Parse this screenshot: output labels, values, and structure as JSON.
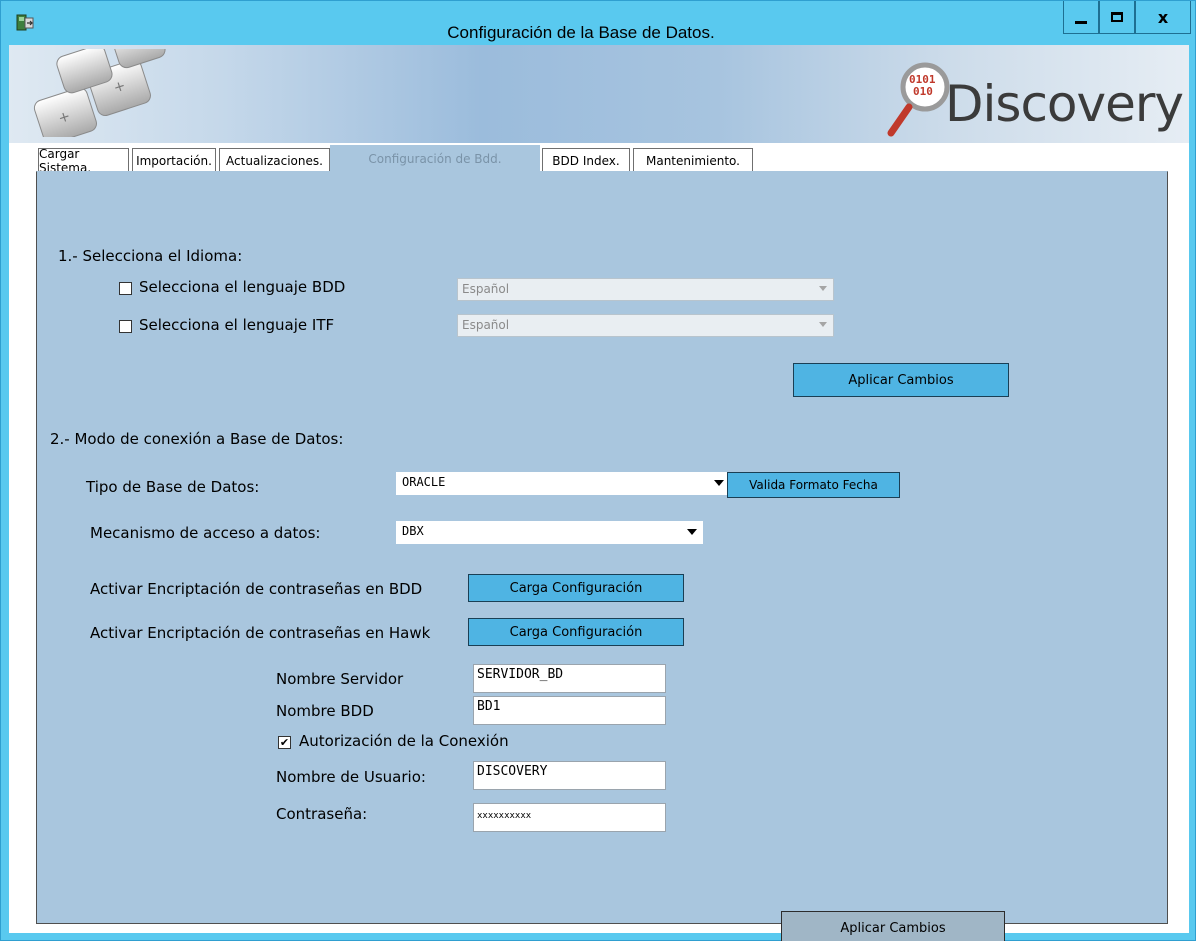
{
  "window": {
    "title": "Configuración de la Base de Datos.",
    "close_glyph": "x"
  },
  "banner": {
    "logo_text": "Discovery",
    "logo_binary": "0101"
  },
  "tabs": [
    {
      "label": "Cargar Sistema."
    },
    {
      "label": "Importación."
    },
    {
      "label": "Actualizaciones."
    },
    {
      "label": "Configuración de Bdd."
    },
    {
      "label": "BDD Index."
    },
    {
      "label": "Mantenimiento."
    }
  ],
  "active_tab": "Configuración de Bdd.",
  "section1": {
    "heading": "1.- Selecciona el Idioma:",
    "lang_bdd": {
      "label": "Selecciona el lenguaje BDD",
      "checked": false,
      "value": "Español"
    },
    "lang_itf": {
      "label": "Selecciona el lenguaje ITF",
      "checked": false,
      "value": "Español"
    },
    "apply_label": "Aplicar Cambios"
  },
  "section2": {
    "heading": "2.- Modo de conexión a Base de Datos:",
    "db_type_label": "Tipo de Base de Datos:",
    "db_type_value": "ORACLE",
    "validate_date_label": "Valida Formato Fecha",
    "access_label": "Mecanismo de acceso a datos:",
    "access_value": "DBX",
    "encrypt_bdd_label": "Activar Encriptación de contraseñas en BDD",
    "encrypt_hawk_label": "Activar Encriptación de contraseñas en Hawk",
    "load_config_label": "Carga Configuración",
    "server_label": "Nombre Servidor",
    "server_value": "SERVIDOR_BD",
    "dbname_label": "Nombre BDD",
    "dbname_value": "BD1",
    "auth_label": "Autorización de la Conexión",
    "auth_checked": true,
    "user_label": "Nombre de Usuario:",
    "user_value": "DISCOVERY",
    "password_label": "Contraseña:",
    "password_value": "xxxxxxxxxx",
    "apply_label": "Aplicar Cambios"
  },
  "colors": {
    "titlebar": "#59c9ef",
    "panel": "#a9c6de",
    "button": "#4fb4e3"
  }
}
